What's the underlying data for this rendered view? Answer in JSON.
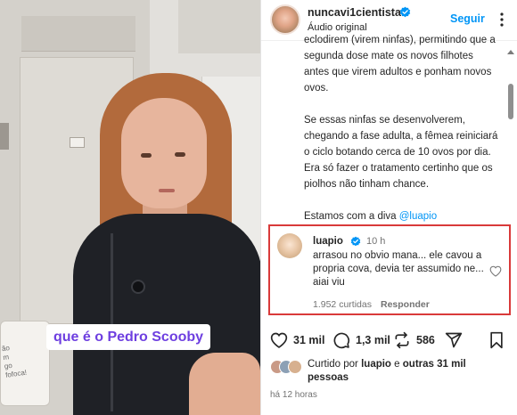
{
  "video": {
    "caption": "que é o Pedro Scooby",
    "mug_text": "ão\nm\ngo\nfofoca!"
  },
  "post": {
    "username": "nuncavi1cientista",
    "subtitle": "Áudio original",
    "follow_label": "Seguir",
    "caption_paragraphs": [
      "eclodirem (virem ninfas), permitindo que a segunda dose mate os novos filhotes antes que virem adultos e ponham novos ovos.",
      "Se essas ninfas se desenvolverem, chegando a fase adulta, a fêmea reiniciará o ciclo botando cerca de 10 ovos por dia. Era só fazer o tratamento certinho que os piolhos não tinham chance."
    ],
    "caption_last_prefix": "Estamos com a diva ",
    "caption_last_mention": "@luapio"
  },
  "comment": {
    "username": "luapio",
    "time": "10 h",
    "text": "arrasou no obvio mana... ele cavou a propria cova, devia ter assumido ne... aiai viu",
    "likes": "1.952 curtidas",
    "reply_label": "Responder"
  },
  "actions": {
    "likes_count": "31 mil",
    "comments_count": "1,3 mil",
    "reposts_count": "586"
  },
  "liked_by": {
    "prefix": "Curtido por ",
    "user": "luapio",
    "middle": " e ",
    "others": "outras 31 mil pessoas"
  },
  "time_ago": "há 12 horas",
  "colors": {
    "accent_blue": "#0095f6",
    "caption_purple": "#6e3fe0",
    "highlight_red": "#d93a3a"
  },
  "icons": [
    "verified-badge-icon",
    "more-options-icon",
    "heart-icon",
    "comment-icon",
    "repost-icon",
    "share-icon",
    "save-icon",
    "scroll-up-arrow-icon"
  ]
}
